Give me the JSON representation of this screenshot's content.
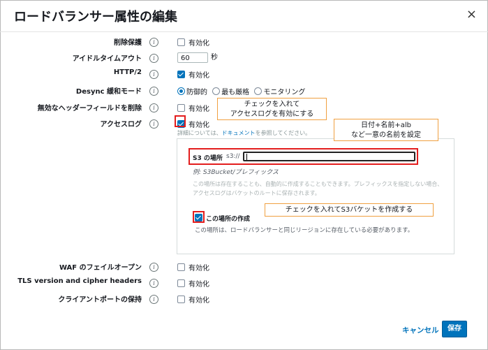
{
  "dialog": {
    "title": "ロードバランサー属性の編集",
    "close_glyph": "×"
  },
  "attributes": [
    {
      "label": "削除保護",
      "type": "checkbox",
      "checked": false,
      "text": "有効化"
    },
    {
      "label": "アイドルタイムアウト",
      "type": "input",
      "value": "60",
      "unit": "秒"
    },
    {
      "label": "HTTP/2",
      "type": "checkbox",
      "checked": true,
      "text": "有効化"
    },
    {
      "label": "Desync 緩和モード",
      "type": "radio",
      "options": [
        "防御的",
        "最も厳格",
        "モニタリング"
      ],
      "selected": "防御的"
    },
    {
      "label": "無効なヘッダーフィールドを削除",
      "type": "checkbox",
      "checked": false,
      "text": "有効化"
    },
    {
      "label": "アクセスログ",
      "type": "checkbox",
      "checked": true,
      "text": "有効化"
    },
    {
      "label": "WAF のフェイルオープン",
      "type": "checkbox",
      "checked": false,
      "text": "有効化"
    },
    {
      "label": "TLS version and cipher headers",
      "type": "checkbox",
      "checked": false,
      "text": "有効化"
    },
    {
      "label": "クライアントポートの保持",
      "type": "checkbox",
      "checked": false,
      "text": "有効化"
    }
  ],
  "access_log": {
    "hint_prefix": "詳細については、",
    "hint_link": "ドキュメント",
    "hint_suffix": "を参照してください。",
    "s3_label": "S3 の場所",
    "s3_prefix": "s3://",
    "s3_value": "",
    "example": "例: S3Bucket/プレフィックス",
    "description": "この場所は存在することも、自動的に作成することもできます。プレフィックスを指定しない場合、アクセスログはバケットのルートに保存されます。",
    "create_label": "この場所の作成",
    "create_checked": true,
    "create_note": "この場所は、ロードバランサーと同じリージョンに存在している必要があります。"
  },
  "annotations": {
    "callout_access_log": [
      "チェックを入れて",
      "アクセスログを有効にする"
    ],
    "callout_s3_name": [
      "日付+名前+alb",
      "など一意の名前を設定"
    ],
    "callout_create": "チェックを入れてS3バケットを作成する"
  },
  "footer": {
    "cancel_label": "キャンセル",
    "save_label": "保存"
  },
  "colors": {
    "accent": "#0073bb",
    "highlight_red": "#e31d1d",
    "callout_border": "#f0a040"
  },
  "icons": {
    "info": "info-icon",
    "close": "close-icon"
  }
}
